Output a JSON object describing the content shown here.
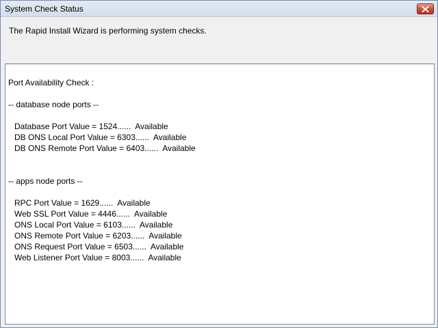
{
  "window": {
    "title": "System Check Status"
  },
  "header": {
    "message": "The Rapid Install Wizard is performing system checks."
  },
  "log": {
    "heading": "Port Availability Check :",
    "db_section": "-- database node ports --",
    "db_lines": [
      "Database Port Value = 1524......  Available",
      "DB ONS Local Port Value = 6303......  Available",
      "DB ONS Remote Port Value = 6403......  Available"
    ],
    "apps_section": "-- apps node ports --",
    "apps_lines": [
      "RPC Port Value = 1629......  Available",
      "Web SSL Port Value = 4446......  Available",
      "ONS Local Port Value = 6103......  Available",
      "ONS Remote Port Value = 6203......  Available",
      "ONS Request Port Value = 6503......  Available",
      "Web Listener Port Value = 8003......  Available"
    ]
  },
  "icons": {
    "close": "close-icon"
  }
}
